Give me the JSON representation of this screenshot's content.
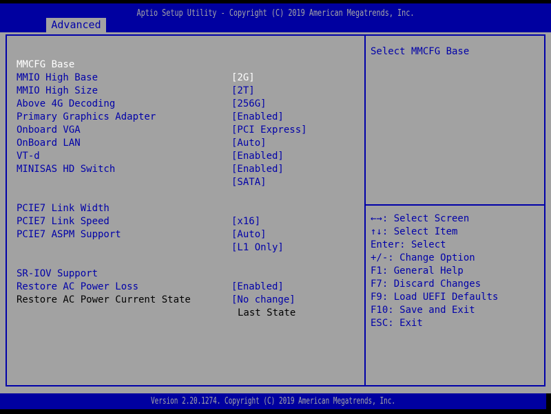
{
  "colors": {
    "blue": "#0000A8",
    "panel_bg": "#A2A2A2",
    "bar_bg": "#0000A0",
    "bar_text": "#A6A6A6",
    "selected_text": "#FFFFFF",
    "info_text": "#000000"
  },
  "header": {
    "title": "Aptio Setup Utility - Copyright (C) 2019 American Megatrends, Inc.",
    "tab": "Advanced"
  },
  "left_panel": {
    "items": [
      {
        "label": "MMCFG Base",
        "value": "[2G]",
        "state": "selected"
      },
      {
        "label": "MMIO High Base",
        "value": "[2T]"
      },
      {
        "label": "MMIO High Size",
        "value": "[256G]"
      },
      {
        "label": "Above 4G Decoding",
        "value": "[Enabled]"
      },
      {
        "label": "Primary Graphics Adapter",
        "value": "[PCI Express]"
      },
      {
        "label": "Onboard VGA",
        "value": "[Auto]"
      },
      {
        "label": "OnBoard LAN",
        "value": "[Enabled]"
      },
      {
        "label": "VT-d",
        "value": "[Enabled]"
      },
      {
        "label": "MINISAS HD Switch",
        "value": "[SATA]"
      },
      {
        "label": "PCIE7 Link Width",
        "value": "[x16]",
        "gap_before": true
      },
      {
        "label": "PCIE7 Link Speed",
        "value": "[Auto]"
      },
      {
        "label": "PCIE7 ASPM Support",
        "value": "[L1 Only]"
      },
      {
        "label": "SR-IOV Support",
        "value": "[Enabled]",
        "gap_before": true
      },
      {
        "label": "Restore AC Power Loss",
        "value": "[No change]"
      },
      {
        "label": "Restore AC Power Current State",
        "value": "Last State",
        "state": "info"
      }
    ]
  },
  "right_panel": {
    "help": "Select MMCFG Base",
    "legend": [
      "←→: Select Screen",
      "↑↓: Select Item",
      "Enter: Select",
      "+/-: Change Option",
      "F1: General Help",
      "F7: Discard Changes",
      "F9: Load UEFI Defaults",
      "F10: Save and Exit",
      "ESC: Exit"
    ]
  },
  "footer": {
    "text": "Version 2.20.1274. Copyright (C) 2019 American Megatrends, Inc."
  }
}
